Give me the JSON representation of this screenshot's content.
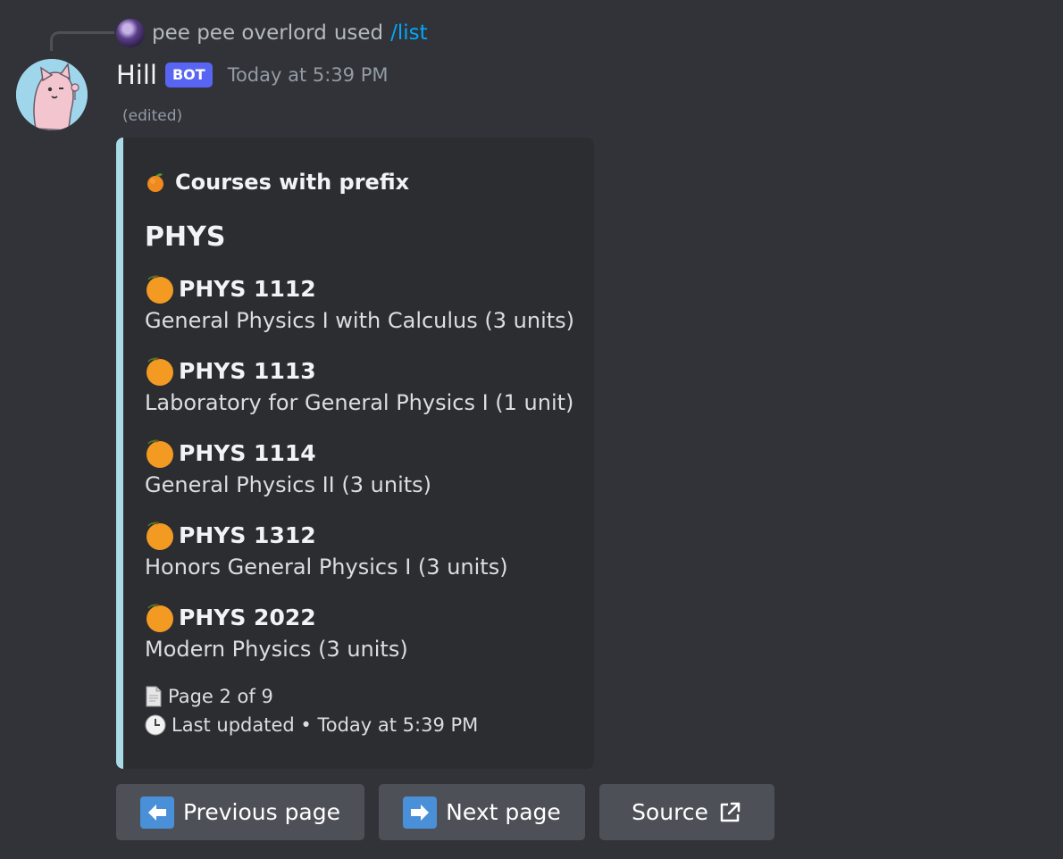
{
  "reply": {
    "username": "pee pee overlord",
    "action": "used",
    "command": "/list"
  },
  "message": {
    "username": "Hill",
    "bot_tag": "BOT",
    "timestamp": "Today at 5:39 PM",
    "edited": "(edited)"
  },
  "embed": {
    "accent_color": "#a9dbe6",
    "author": "Courses with prefix",
    "title": "PHYS",
    "fields": [
      {
        "name": "PHYS 1112",
        "value": "General Physics I with Calculus (3 units)"
      },
      {
        "name": "PHYS 1113",
        "value": "Laboratory for General Physics I (1 unit)"
      },
      {
        "name": "PHYS 1114",
        "value": "General Physics II (3 units)"
      },
      {
        "name": "PHYS 1312",
        "value": "Honors General Physics I (3 units)"
      },
      {
        "name": "PHYS 2022",
        "value": "Modern Physics (3 units)"
      }
    ],
    "footer_page": "Page 2 of 9",
    "footer_updated": "Last updated • Today at 5:39 PM"
  },
  "buttons": {
    "previous": "Previous page",
    "next": "Next page",
    "source": "Source"
  },
  "icons": {
    "field_icon": "orange-icon",
    "page_icon": "page-icon",
    "clock_icon": "clock-icon",
    "prev_icon": "left-arrow-icon",
    "next_icon": "right-arrow-icon",
    "source_icon": "external-link-icon"
  }
}
